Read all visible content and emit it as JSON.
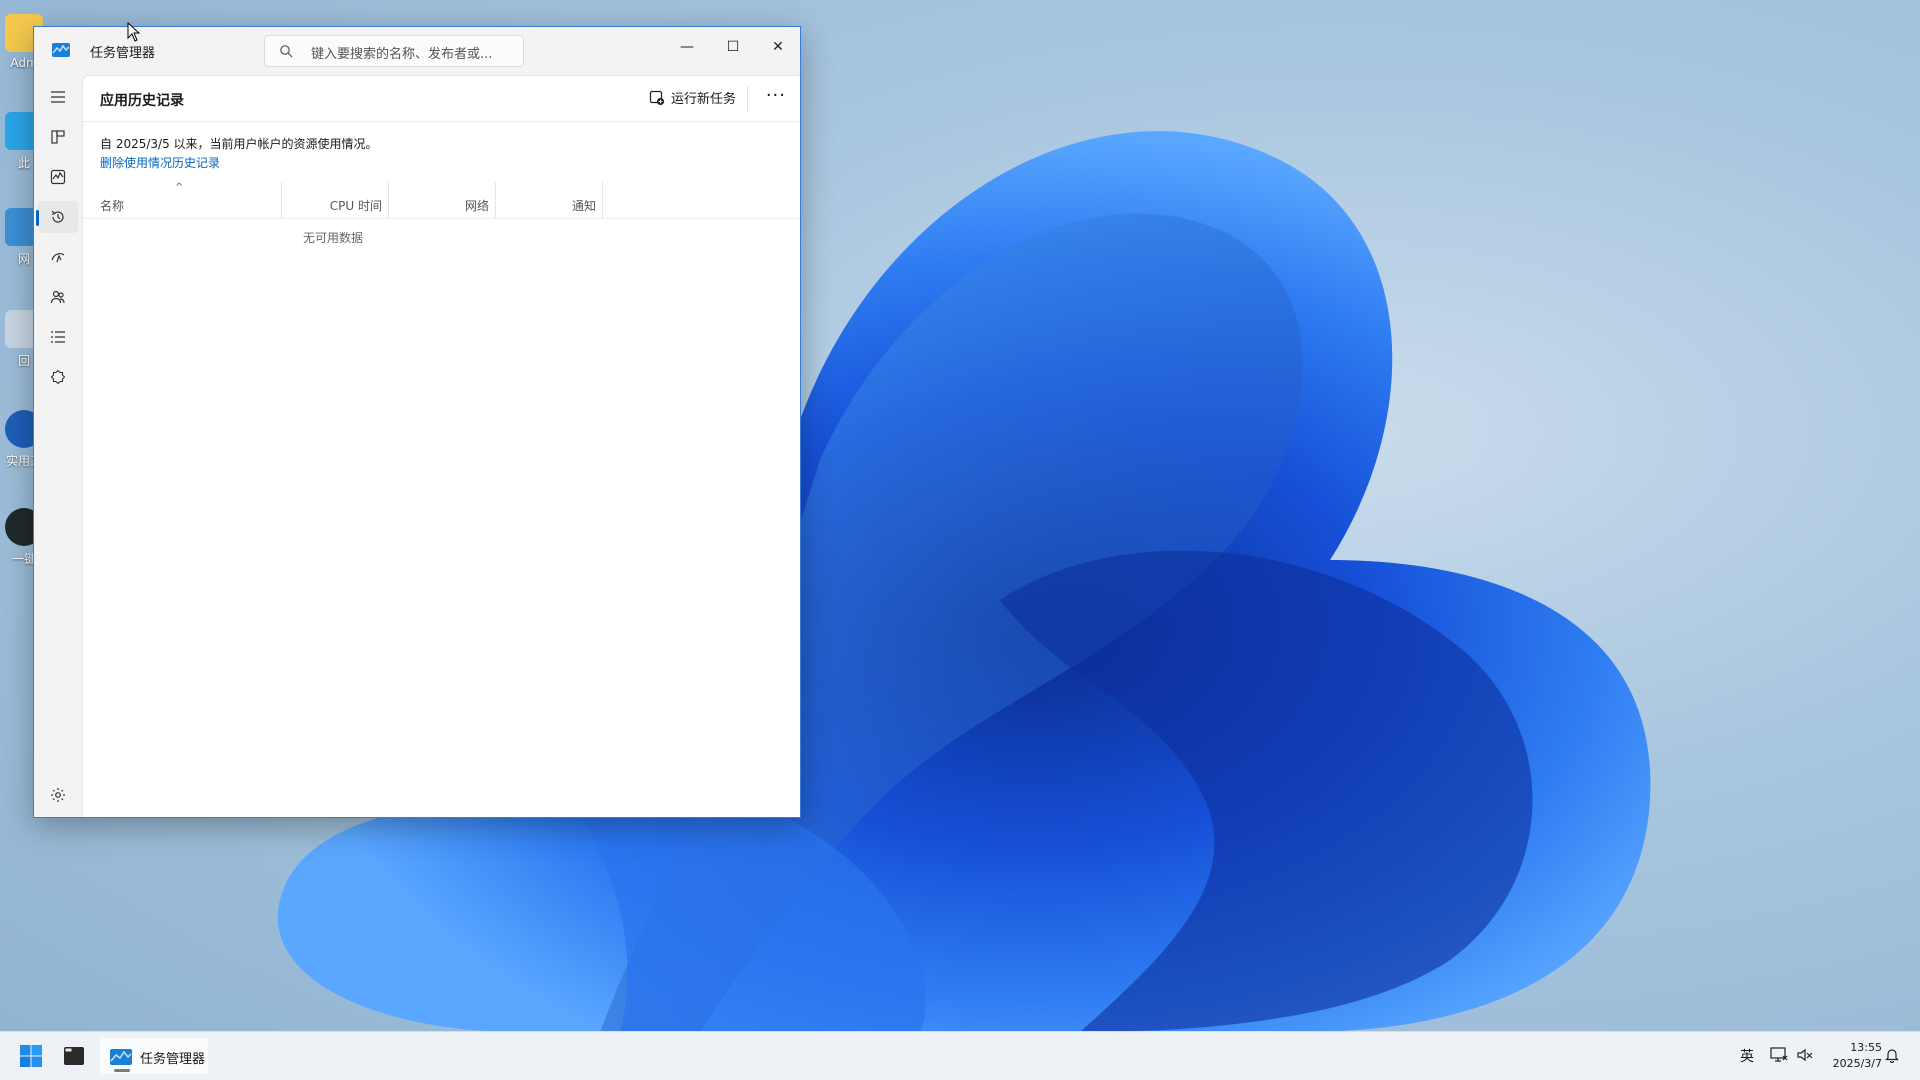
{
  "desktop": {
    "icons": [
      {
        "label": "Adm"
      },
      {
        "label": "此"
      },
      {
        "label": "网"
      },
      {
        "label": "回"
      },
      {
        "label": "实用工"
      },
      {
        "label": "一键"
      }
    ]
  },
  "window": {
    "title": "任务管理器",
    "search_placeholder": "键入要搜索的名称、发布者或...",
    "controls": {
      "minimize": "—",
      "maximize": "☐",
      "close": "✕"
    }
  },
  "sidebar": {
    "items": [
      {
        "name": "menu",
        "icon": "hamburger-icon"
      },
      {
        "name": "processes",
        "icon": "processes-icon"
      },
      {
        "name": "performance",
        "icon": "performance-icon"
      },
      {
        "name": "app-history",
        "icon": "history-icon",
        "active": true
      },
      {
        "name": "startup-apps",
        "icon": "startup-icon"
      },
      {
        "name": "users",
        "icon": "users-icon"
      },
      {
        "name": "details",
        "icon": "details-icon"
      },
      {
        "name": "services",
        "icon": "services-icon"
      }
    ],
    "settings_icon": "gear-icon"
  },
  "page": {
    "title": "应用历史记录",
    "run_task": "运行新任务",
    "more": "···",
    "info": "自 2025/3/5 以来，当前用户帐户的资源使用情况。",
    "delete_link": "删除使用情况历史记录",
    "columns": {
      "name": "名称",
      "cpu": "CPU 时间",
      "network": "网络",
      "notify": "通知"
    },
    "sort_caret": "^",
    "empty": "无可用数据"
  },
  "taskbar": {
    "app_label": "任务管理器",
    "lang": "英",
    "time": "13:55",
    "date": "2025/3/7"
  },
  "colors": {
    "accent": "#0067c0",
    "window_border": "#3a7bd5"
  }
}
